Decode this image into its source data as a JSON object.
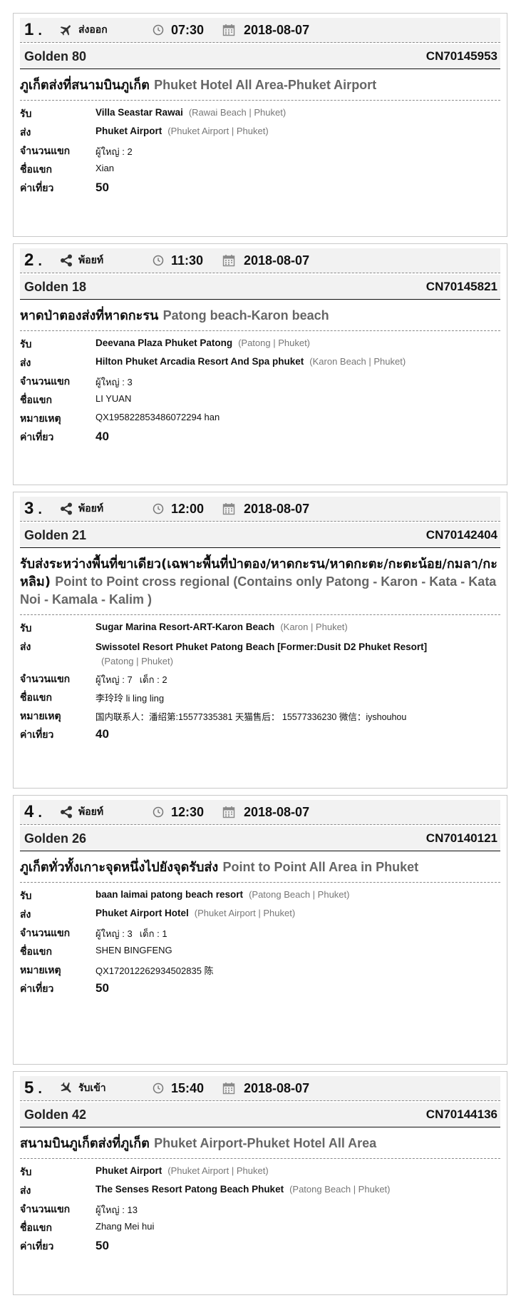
{
  "labels": {
    "pickup": "รับ",
    "dropoff": "ส่ง",
    "guests": "จำนวนแขก",
    "name": "ชื่อแขก",
    "note": "หมายเหตุ",
    "fare": "ค่าเที่ยว",
    "adult": "ผู้ใหญ่ :",
    "child": "เด็ก :"
  },
  "jobs": [
    {
      "num": "1",
      "type": "ส่งออก",
      "type_icon": "airplane-depart-icon",
      "time": "07:30",
      "date": "2018-08-07",
      "car": "Golden 80",
      "code": "CN70145953",
      "route_th": "ภูเก็ตส่งที่สนามบินภูเก็ต",
      "route_en": "Phuket Hotel All Area-Phuket Airport",
      "pickup_name": "Villa Seastar Rawai",
      "pickup_loc": "(Rawai Beach | Phuket)",
      "dropoff_name": "Phuket Airport",
      "dropoff_loc": "(Phuket Airport | Phuket)",
      "adults": "2",
      "children": "",
      "guest_name": "Xian",
      "note": "",
      "fare": "50"
    },
    {
      "num": "2",
      "type": "พ้อยท์",
      "type_icon": "share-icon",
      "time": "11:30",
      "date": "2018-08-07",
      "car": "Golden 18",
      "code": "CN70145821",
      "route_th": "หาดป่าตองส่งที่หาดกะรน",
      "route_en": "Patong beach-Karon beach",
      "pickup_name": "Deevana Plaza Phuket Patong",
      "pickup_loc": "(Patong | Phuket)",
      "dropoff_name": "Hilton Phuket Arcadia Resort And Spa phuket",
      "dropoff_loc": "(Karon Beach | Phuket)",
      "adults": "3",
      "children": "",
      "guest_name": "LI YUAN",
      "note": "QX195822853486072294 han",
      "fare": "40"
    },
    {
      "num": "3",
      "type": "พ้อยท์",
      "type_icon": "share-icon",
      "time": "12:00",
      "date": "2018-08-07",
      "car": "Golden 21",
      "code": "CN70142404",
      "route_th": "รับส่งระหว่างพื้นที่ขาเดียว(เฉพาะพื้นที่ป่าตอง/หาดกะรน/หาดกะตะ/กะตะน้อย/กมลา/กะหลิม)",
      "route_en": "Point to Point cross regional (Contains only Patong - Karon - Kata - Kata Noi - Kamala - Kalim )",
      "pickup_name": "Sugar Marina Resort-ART-Karon Beach",
      "pickup_loc": "(Karon | Phuket)",
      "dropoff_name": "Swissotel Resort Phuket Patong Beach [Former:Dusit D2 Phuket Resort]",
      "dropoff_loc": "(Patong | Phuket)",
      "adults": "7",
      "children": "2",
      "guest_name": "李玲玲 li ling ling",
      "note": "国内联系人：潘绍第:15577335381 天猫售后： 15577336230 微信：iyshouhou",
      "fare": "40"
    },
    {
      "num": "4",
      "type": "พ้อยท์",
      "type_icon": "share-icon",
      "time": "12:30",
      "date": "2018-08-07",
      "car": "Golden 26",
      "code": "CN70140121",
      "route_th": "ภูเก็ตทั่วทั้งเกาะจุดหนึ่งไปยังจุดรับส่ง",
      "route_en": "Point to Point All Area in Phuket",
      "pickup_name": "baan laimai patong beach resort",
      "pickup_loc": "(Patong Beach | Phuket)",
      "dropoff_name": "Phuket Airport Hotel",
      "dropoff_loc": "(Phuket Airport | Phuket)",
      "adults": "3",
      "children": "1",
      "guest_name": "SHEN BINGFENG",
      "note": "QX172012262934502835 陈",
      "fare": "50"
    },
    {
      "num": "5",
      "type": "รับเข้า",
      "type_icon": "airplane-arrive-icon",
      "time": "15:40",
      "date": "2018-08-07",
      "car": "Golden 42",
      "code": "CN70144136",
      "route_th": "สนามบินภูเก็ตส่งที่ภูเก็ต",
      "route_en": "Phuket Airport-Phuket Hotel All Area",
      "pickup_name": "Phuket Airport",
      "pickup_loc": "(Phuket Airport | Phuket)",
      "dropoff_name": "The Senses Resort Patong Beach Phuket",
      "dropoff_loc": "(Patong Beach | Phuket)",
      "adults": "13",
      "children": "",
      "guest_name": "Zhang Mei hui",
      "note": "",
      "fare": "50"
    }
  ]
}
